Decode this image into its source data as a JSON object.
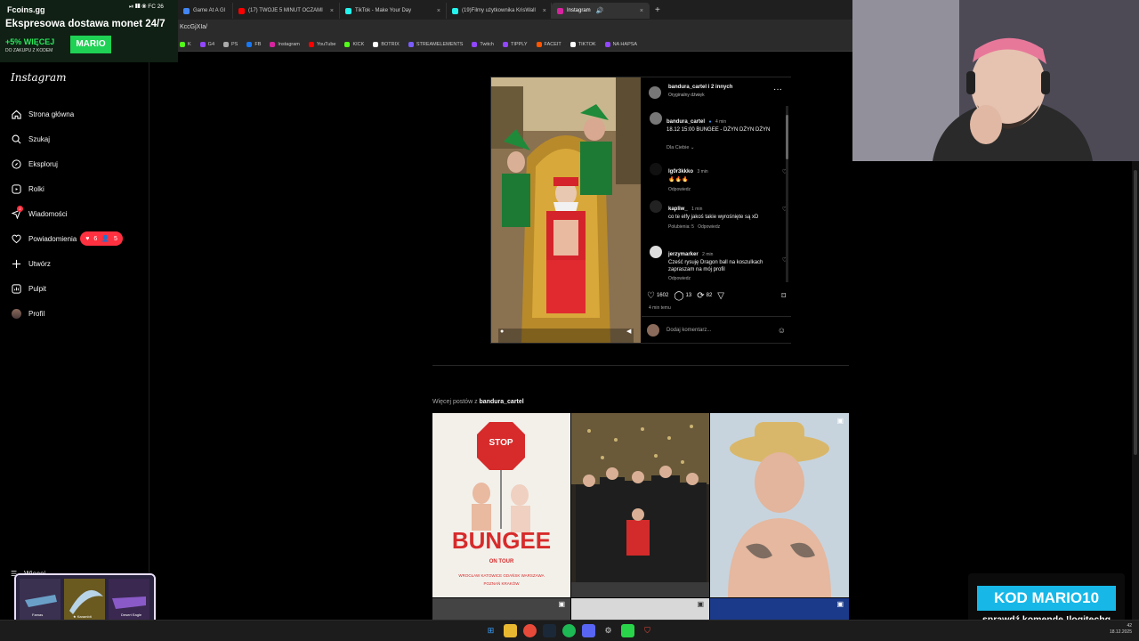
{
  "overlay": {
    "brand": "Fcoins.gg",
    "status": "FC 26",
    "headline": "Ekspresowa dostawa monet 24/7",
    "promo": "+5% WIĘCEJ",
    "promo_sub": "DO ZAKUPU Z KODEM",
    "code": "MARIO"
  },
  "browser": {
    "tabs": [
      {
        "label": "Game At A Gl",
        "color": "#4285f4"
      },
      {
        "label": "(17) TWOJE 5 MINUT OCZAMI",
        "color": "#ff0000"
      },
      {
        "label": "TikTok - Make Your Day",
        "color": "#111111"
      },
      {
        "label": "(19)Filmy użytkownika KrisWall",
        "color": "#111111"
      },
      {
        "label": "Instagram",
        "color": "#d6249f",
        "active": true
      }
    ],
    "url": "KccGjXIa/",
    "bookmarks": [
      {
        "label": "K",
        "color": "#53fc18"
      },
      {
        "label": "G4",
        "color": "#9147ff"
      },
      {
        "label": "PS",
        "color": "#aaaaaa"
      },
      {
        "label": "FB",
        "color": "#1877f2"
      },
      {
        "label": "Instagram",
        "color": "#d6249f"
      },
      {
        "label": "YouTube",
        "color": "#ff0000"
      },
      {
        "label": "KICK",
        "color": "#53fc18"
      },
      {
        "label": "BOTRIX",
        "color": "#ffffff"
      },
      {
        "label": "STREAMELEMENTS",
        "color": "#7a5cff"
      },
      {
        "label": "Twitch",
        "color": "#9147ff"
      },
      {
        "label": "TIPPLY",
        "color": "#9147ff"
      },
      {
        "label": "FACEIT",
        "color": "#ff5500"
      },
      {
        "label": "TIKTOK",
        "color": "#ffffff"
      },
      {
        "label": "NA HAPSA",
        "color": "#9147ff"
      }
    ]
  },
  "sidebar": {
    "logo": "Instagram",
    "items": [
      {
        "label": "Strona główna",
        "icon": "home-icon"
      },
      {
        "label": "Szukaj",
        "icon": "search-icon"
      },
      {
        "label": "Eksploruj",
        "icon": "compass-icon"
      },
      {
        "label": "Rolki",
        "icon": "reels-icon"
      },
      {
        "label": "Wiadomości",
        "icon": "messages-icon",
        "badge": "2"
      },
      {
        "label": "Powiadomienia",
        "icon": "heart-icon"
      },
      {
        "label": "Utwórz",
        "icon": "plus-icon"
      },
      {
        "label": "Pulpit",
        "icon": "dashboard-icon"
      },
      {
        "label": "Profil",
        "icon": "avatar"
      }
    ],
    "notif_likes": "6",
    "notif_follows": "5",
    "more": "Więcej"
  },
  "post": {
    "header_user": "bandura_cartel i 2 innych",
    "audio": "Oryginalny dźwięk",
    "caption_user": "bandura_cartel",
    "caption_time": "4 min",
    "caption": "18.12 15:00 BUNGEE - DŻYN DŻYN DŻYN",
    "filter": "Dla Ciebie",
    "comments": [
      {
        "user": "lg0r3kkko",
        "time": "3 min",
        "text": "🔥🔥🔥",
        "meta": [
          "Odpowiedz"
        ]
      },
      {
        "user": "kapliw_",
        "time": "1 min",
        "text": "co te elfy jakoś takie wyrośnięte są xD",
        "meta": [
          "Polubienia: 5",
          "Odpowiedz"
        ]
      },
      {
        "user": "jerzymarker",
        "time": "2 min",
        "text": "Cześć rysuję Dragon ball na koszulkach zapraszam na mój profil",
        "meta": [
          "Odpowiedz"
        ]
      }
    ],
    "likes": "1602",
    "comments_count": "13",
    "reposts": "82",
    "time_ago": "4 min temu",
    "add_comment_placeholder": "Dodaj komentarz..."
  },
  "more_posts": {
    "prefix": "Więcej postów z",
    "user": "bandura_cartel"
  },
  "tiles": {
    "bungee_title": "BUNGEE",
    "bungee_sub": "ON TOUR",
    "stop": "STOP",
    "cities": "WROCŁAW  KATOWICE  GDAŃSK  WARSZAWA  POZNAŃ  KRAKÓW"
  },
  "bottom": {
    "kod": "KOD MARIO10",
    "kod_sub": "sprawdź komendę !logitechg",
    "knife_labels": [
      "Famas",
      "★ Karambit",
      "Desert Eagle"
    ]
  },
  "taskbar": {
    "clock_time": "42",
    "clock_date": "18.12.2025"
  },
  "colors": {
    "accent_red": "#ff3040",
    "kod_blue": "#17b8e8",
    "promo_green": "#1fd154"
  }
}
